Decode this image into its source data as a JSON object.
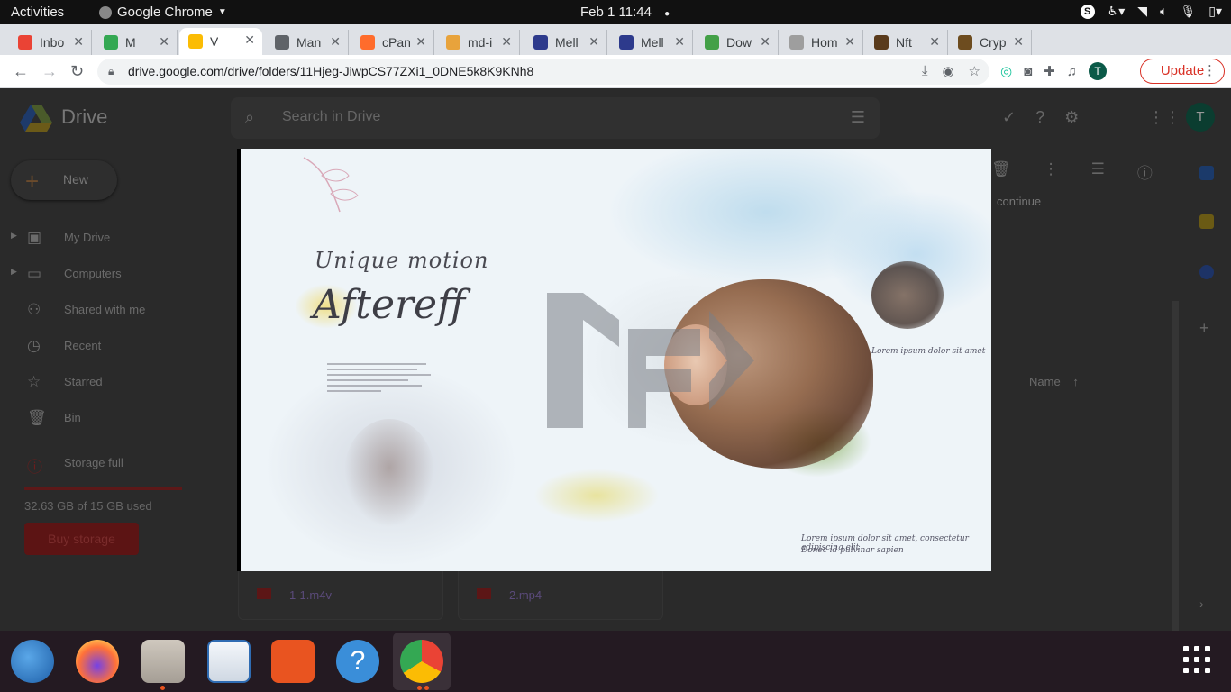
{
  "system_bar": {
    "activities": "Activities",
    "app_name": "Google Chrome",
    "clock": "Feb 1  11:44",
    "tray_badge": "S"
  },
  "tabs": [
    {
      "label": "Inbo",
      "favicon": "gmail-icon",
      "color": "#ea4335"
    },
    {
      "label": "M",
      "favicon": "meet-icon",
      "color": "#34a853"
    },
    {
      "label": "V",
      "favicon": "drive-icon",
      "color": "#fbbc04"
    },
    {
      "label": "Man",
      "favicon": "globe-icon",
      "color": "#5f6368"
    },
    {
      "label": "cPan",
      "favicon": "cpanel-icon",
      "color": "#ff6c2c"
    },
    {
      "label": "md-i",
      "favicon": "md-icon",
      "color": "#e8a33c"
    },
    {
      "label": "Mell",
      "favicon": "mellow-icon",
      "color": "#2d3a8c"
    },
    {
      "label": "Mell",
      "favicon": "mellow-icon",
      "color": "#2d3a8c"
    },
    {
      "label": "Dow",
      "favicon": "leaf-icon",
      "color": "#43a047"
    },
    {
      "label": "Hom",
      "favicon": "home-icon",
      "color": "#9e9e9e"
    },
    {
      "label": "Nft",
      "favicon": "nft-icon",
      "color": "#5a3b1c"
    },
    {
      "label": "Cryp",
      "favicon": "crypto-icon",
      "color": "#6d4c1f"
    }
  ],
  "address_bar": {
    "url": "drive.google.com/drive/folders/11Hjeg-JiwpCS77ZXi1_0DNE5k8K9KNh8",
    "profile_initial": "T",
    "update_label": "Update"
  },
  "drive": {
    "brand": "Drive",
    "search_placeholder": "Search in Drive",
    "account_initial": "T",
    "new_label": "New",
    "nav": [
      {
        "label": "My Drive",
        "icon": "my-drive-icon",
        "glyph": "▣",
        "expandable": true
      },
      {
        "label": "Computers",
        "icon": "computer-icon",
        "glyph": "▭",
        "expandable": true
      },
      {
        "label": "Shared with me",
        "icon": "shared-icon",
        "glyph": "⚇",
        "expandable": false
      },
      {
        "label": "Recent",
        "icon": "clock-icon",
        "glyph": "◷",
        "expandable": false
      },
      {
        "label": "Starred",
        "icon": "star-icon",
        "glyph": "☆",
        "expandable": false
      },
      {
        "label": "Bin",
        "icon": "bin-icon",
        "glyph": "🗑",
        "expandable": false
      }
    ],
    "storage_label": "Storage full",
    "storage_used": "32.63 GB of 15 GB used",
    "buy_storage": "Buy storage",
    "continue_text": "continue",
    "name_column": "Name",
    "files": [
      "1-1.m4v",
      "2.mp4"
    ]
  },
  "video": {
    "title_script": "Unique motion",
    "title_main": "Aftereff",
    "caption_right": "Lorem ipsum dolor sit amet",
    "caption_bottom_1": "Lorem ipsum dolor sit amet, consectetur adipiscing elit",
    "caption_bottom_2": "Donec id pulvinar sapien"
  },
  "colors": {
    "accent_red": "#d93025",
    "dock_active": "#e95420"
  }
}
